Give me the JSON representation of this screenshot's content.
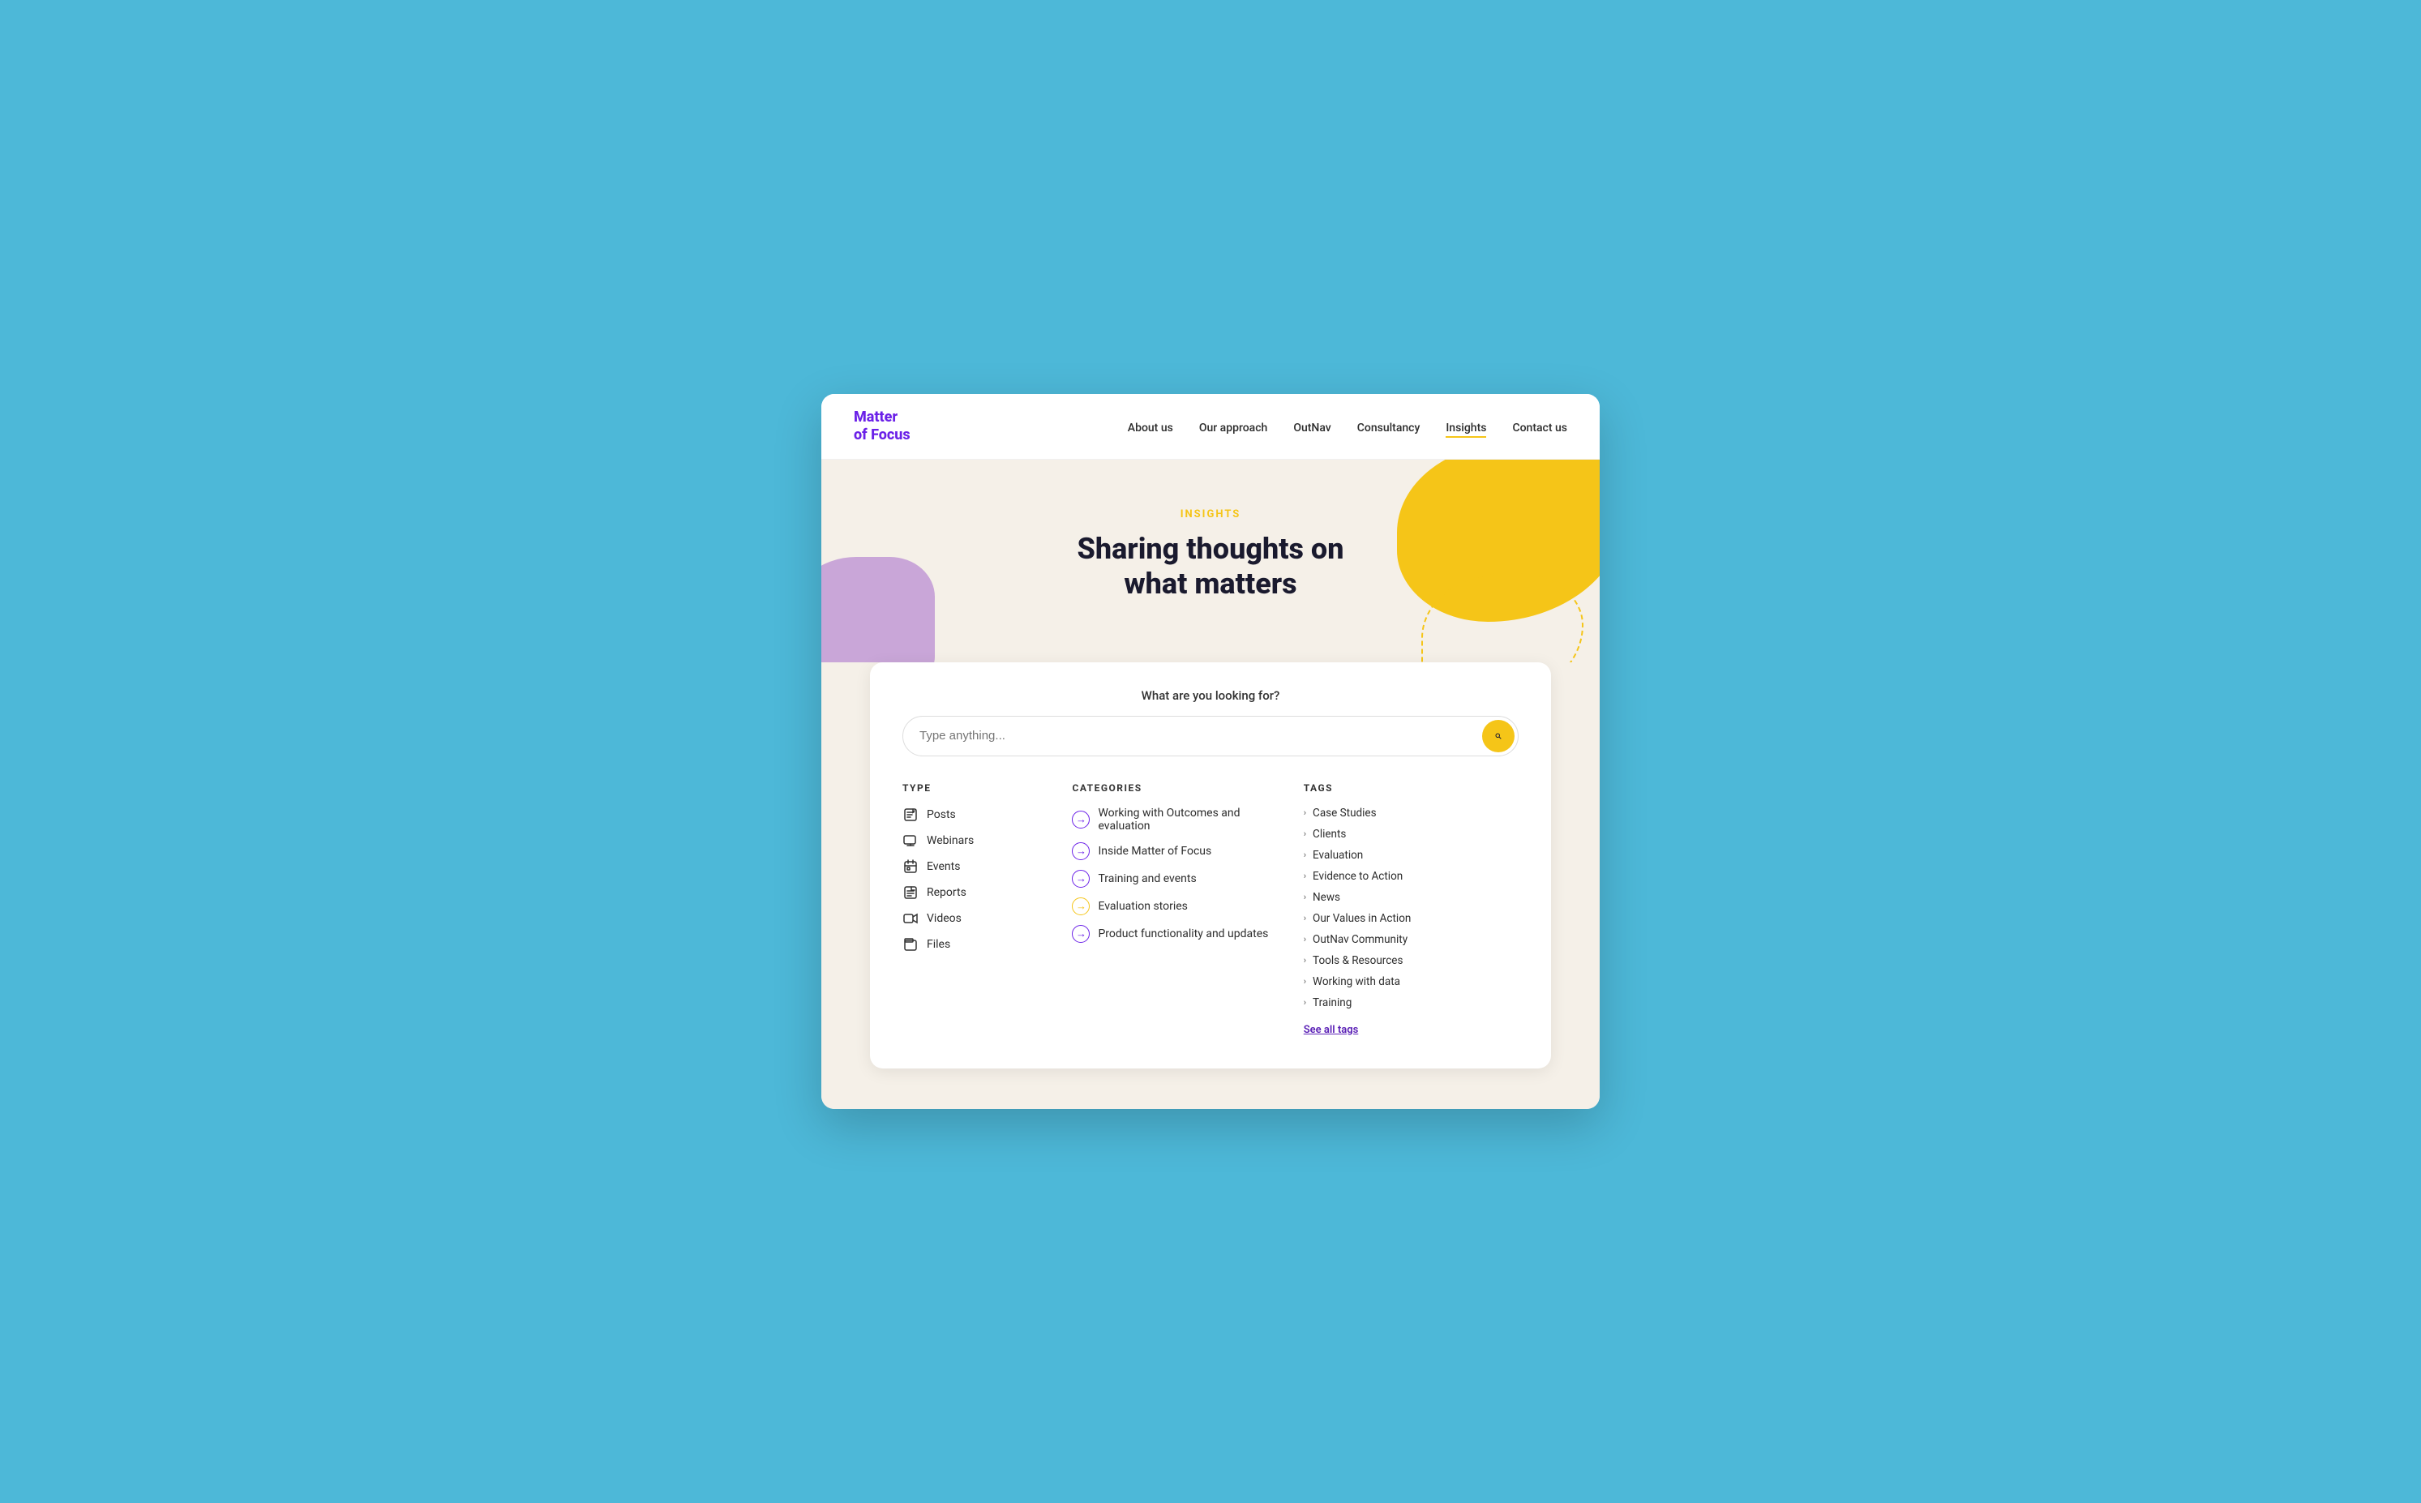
{
  "logo": {
    "line1": "Matter",
    "line2": "of Focus"
  },
  "nav": {
    "links": [
      {
        "id": "about-us",
        "label": "About us",
        "active": false
      },
      {
        "id": "our-approach",
        "label": "Our approach",
        "active": false
      },
      {
        "id": "outnav",
        "label": "OutNav",
        "active": false
      },
      {
        "id": "consultancy",
        "label": "Consultancy",
        "active": false
      },
      {
        "id": "insights",
        "label": "Insights",
        "active": true
      },
      {
        "id": "contact-us",
        "label": "Contact us",
        "active": false
      }
    ]
  },
  "hero": {
    "tag": "INSIGHTS",
    "title_line1": "Sharing thoughts on",
    "title_line2": "what matters"
  },
  "search": {
    "label": "What are you looking for?",
    "placeholder": "Type anything...",
    "button_aria": "Search"
  },
  "type": {
    "heading": "TYPE",
    "items": [
      {
        "id": "posts",
        "label": "Posts"
      },
      {
        "id": "webinars",
        "label": "Webinars"
      },
      {
        "id": "events",
        "label": "Events"
      },
      {
        "id": "reports",
        "label": "Reports"
      },
      {
        "id": "videos",
        "label": "Videos"
      },
      {
        "id": "files",
        "label": "Files"
      }
    ]
  },
  "categories": {
    "heading": "CATEGORIES",
    "items": [
      {
        "id": "outcomes-evaluation",
        "label": "Working with Outcomes and evaluation",
        "color": "purple"
      },
      {
        "id": "inside-mof",
        "label": "Inside Matter of Focus",
        "color": "purple"
      },
      {
        "id": "training-events",
        "label": "Training and events",
        "color": "purple"
      },
      {
        "id": "evaluation-stories",
        "label": "Evaluation stories",
        "color": "yellow"
      },
      {
        "id": "product-functionality",
        "label": "Product functionality and updates",
        "color": "purple"
      }
    ]
  },
  "tags": {
    "heading": "TAGS",
    "items": [
      {
        "id": "case-studies",
        "label": "Case Studies"
      },
      {
        "id": "clients",
        "label": "Clients"
      },
      {
        "id": "evaluation",
        "label": "Evaluation"
      },
      {
        "id": "evidence-to-action",
        "label": "Evidence to Action"
      },
      {
        "id": "news",
        "label": "News"
      },
      {
        "id": "our-values-in-action",
        "label": "Our Values in Action"
      },
      {
        "id": "outnav-community",
        "label": "OutNav Community"
      },
      {
        "id": "tools-resources",
        "label": "Tools & Resources"
      },
      {
        "id": "working-with-data",
        "label": "Working with data"
      },
      {
        "id": "training",
        "label": "Training"
      }
    ],
    "see_all_label": "See all tags"
  }
}
